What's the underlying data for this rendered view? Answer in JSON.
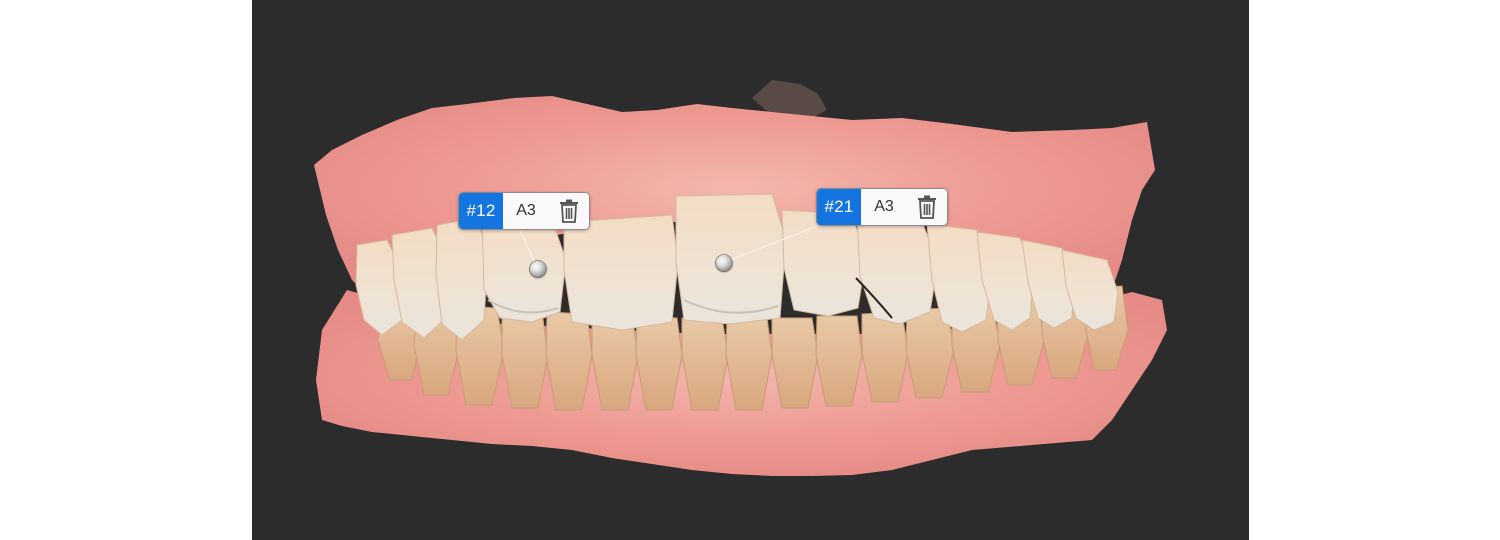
{
  "viewer": {
    "background_color": "#2d2c2d",
    "accent_color": "#1474e0"
  },
  "annotations": [
    {
      "tooth_number": "#12",
      "shade": "A3",
      "delete_icon": "trash-icon"
    },
    {
      "tooth_number": "#21",
      "shade": "A3",
      "delete_icon": "trash-icon"
    }
  ]
}
